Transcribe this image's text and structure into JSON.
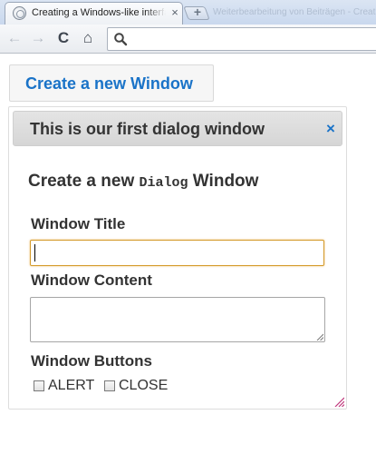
{
  "browser": {
    "tab_title": "Creating a Windows-like interface with jQuery UI",
    "tab_close_glyph": "×",
    "new_tab_glyph": "+",
    "background_tab_text": "Weiterbearbeitung von Beiträgen - Creating a Win...",
    "back_glyph": "←",
    "forward_glyph": "→",
    "reload_glyph": "C",
    "home_glyph": "⌂",
    "icons": {
      "favicon": "globe-icon",
      "back": "back-arrow-icon",
      "forward": "forward-arrow-icon",
      "reload": "reload-icon",
      "home": "home-icon",
      "search": "search-icon"
    }
  },
  "page": {
    "create_button_label": "Create a new Window",
    "dialog": {
      "title": "This is our first dialog window",
      "close_glyph": "×",
      "heading_before": "Create a new ",
      "heading_code": "Dialog",
      "heading_after": " Window",
      "window_title_label": "Window Title",
      "window_title_value": "",
      "window_content_label": "Window Content",
      "window_content_value": "",
      "window_buttons_label": "Window Buttons",
      "checkboxes": [
        {
          "label": "ALERT",
          "checked": false
        },
        {
          "label": "CLOSE",
          "checked": false
        }
      ]
    }
  },
  "colors": {
    "accent_blue": "#1a73c8",
    "focus_orange": "#d49a2a",
    "dialog_header": "#dadada",
    "resize_grip": "#c0397d"
  }
}
